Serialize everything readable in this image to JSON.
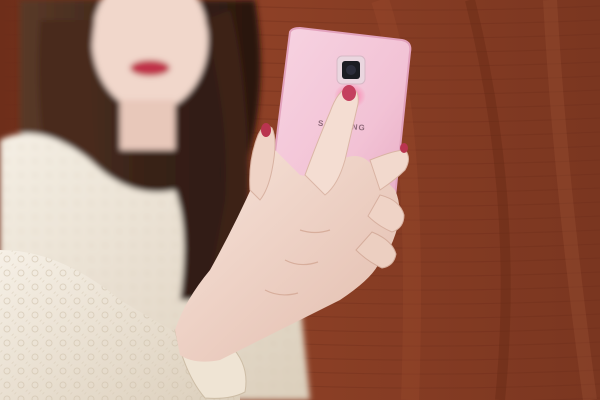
{
  "photo": {
    "phone_brand": "SAMSUNG",
    "colors": {
      "wall_base": "#8a3f24",
      "wall_dark": "#5e2414",
      "wall_light": "#a2543a",
      "hair": "#3a2318",
      "hair_highlight": "#6b4330",
      "skin": "#f2d8cc",
      "skin_shadow": "#dcb6a6",
      "sweater": "#f3ece0",
      "sweater_shadow": "#d9cdb9",
      "phone_body": "#f3c6d8",
      "phone_edge": "#e6a9c2",
      "lips": "#c0304a",
      "nail": "#c4405e",
      "flash_glow": "#ff6fa0"
    }
  }
}
